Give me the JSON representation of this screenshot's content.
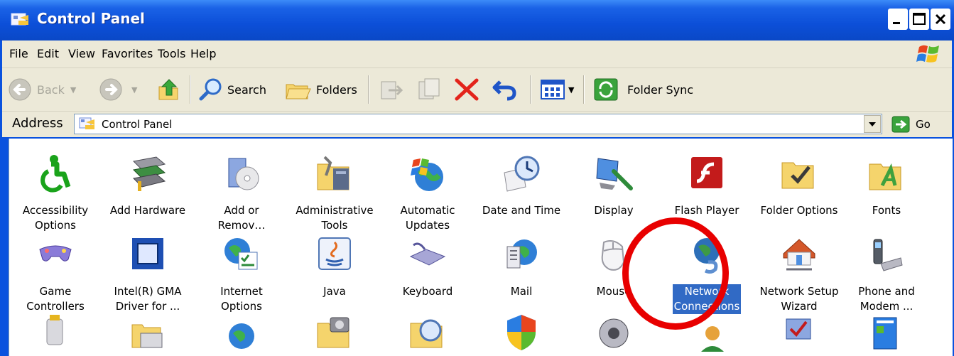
{
  "window": {
    "title": "Control Panel"
  },
  "menu": [
    "File",
    "Edit",
    "View",
    "Favorites",
    "Tools",
    "Help"
  ],
  "toolbar": {
    "back_label": "Back",
    "search_label": "Search",
    "folders_label": "Folders",
    "folder_sync_label": "Folder Sync"
  },
  "address": {
    "label": "Address",
    "value": "Control Panel",
    "go_label": "Go"
  },
  "items": [
    {
      "label_lines": [
        "Accessibility",
        "Options"
      ],
      "icon": "accessibility-icon"
    },
    {
      "label_lines": [
        "Add Hardware"
      ],
      "icon": "add-hardware-icon"
    },
    {
      "label_lines": [
        "Add or",
        "Remov…"
      ],
      "icon": "add-remove-programs-icon"
    },
    {
      "label_lines": [
        "Administrative",
        "Tools"
      ],
      "icon": "administrative-tools-icon"
    },
    {
      "label_lines": [
        "Automatic",
        "Updates"
      ],
      "icon": "automatic-updates-icon"
    },
    {
      "label_lines": [
        "Date and Time"
      ],
      "icon": "date-time-icon"
    },
    {
      "label_lines": [
        "Display"
      ],
      "icon": "display-icon"
    },
    {
      "label_lines": [
        "Flash Player"
      ],
      "icon": "flash-player-icon"
    },
    {
      "label_lines": [
        "Folder Options"
      ],
      "icon": "folder-options-icon"
    },
    {
      "label_lines": [
        "Fonts"
      ],
      "icon": "fonts-icon"
    },
    {
      "label_lines": [
        "Game",
        "Controllers"
      ],
      "icon": "game-controllers-icon"
    },
    {
      "label_lines": [
        "Intel(R) GMA",
        "Driver for ..."
      ],
      "icon": "intel-gma-icon"
    },
    {
      "label_lines": [
        "Internet",
        "Options"
      ],
      "icon": "internet-options-icon"
    },
    {
      "label_lines": [
        "Java"
      ],
      "icon": "java-icon"
    },
    {
      "label_lines": [
        "Keyboard"
      ],
      "icon": "keyboard-icon"
    },
    {
      "label_lines": [
        "Mail"
      ],
      "icon": "mail-icon"
    },
    {
      "label_lines": [
        "Mouse"
      ],
      "icon": "mouse-icon"
    },
    {
      "label_lines": [
        "Network",
        "Connections"
      ],
      "icon": "network-connections-icon",
      "selected": true
    },
    {
      "label_lines": [
        "Network Setup",
        "Wizard"
      ],
      "icon": "network-setup-wizard-icon"
    },
    {
      "label_lines": [
        "Phone and",
        "Modem ..."
      ],
      "icon": "phone-modem-icon"
    },
    {
      "label_lines": [],
      "icon": "power-options-icon"
    },
    {
      "label_lines": [],
      "icon": "printers-icon"
    },
    {
      "label_lines": [],
      "icon": "regional-options-icon"
    },
    {
      "label_lines": [],
      "icon": "scanners-cameras-icon"
    },
    {
      "label_lines": [],
      "icon": "scheduled-tasks-icon"
    },
    {
      "label_lines": [],
      "icon": "security-center-icon"
    },
    {
      "label_lines": [],
      "icon": "sounds-icon"
    },
    {
      "label_lines": [],
      "icon": "speech-icon"
    },
    {
      "label_lines": [],
      "icon": "system-icon"
    },
    {
      "label_lines": [],
      "icon": "taskbar-icon"
    }
  ]
}
